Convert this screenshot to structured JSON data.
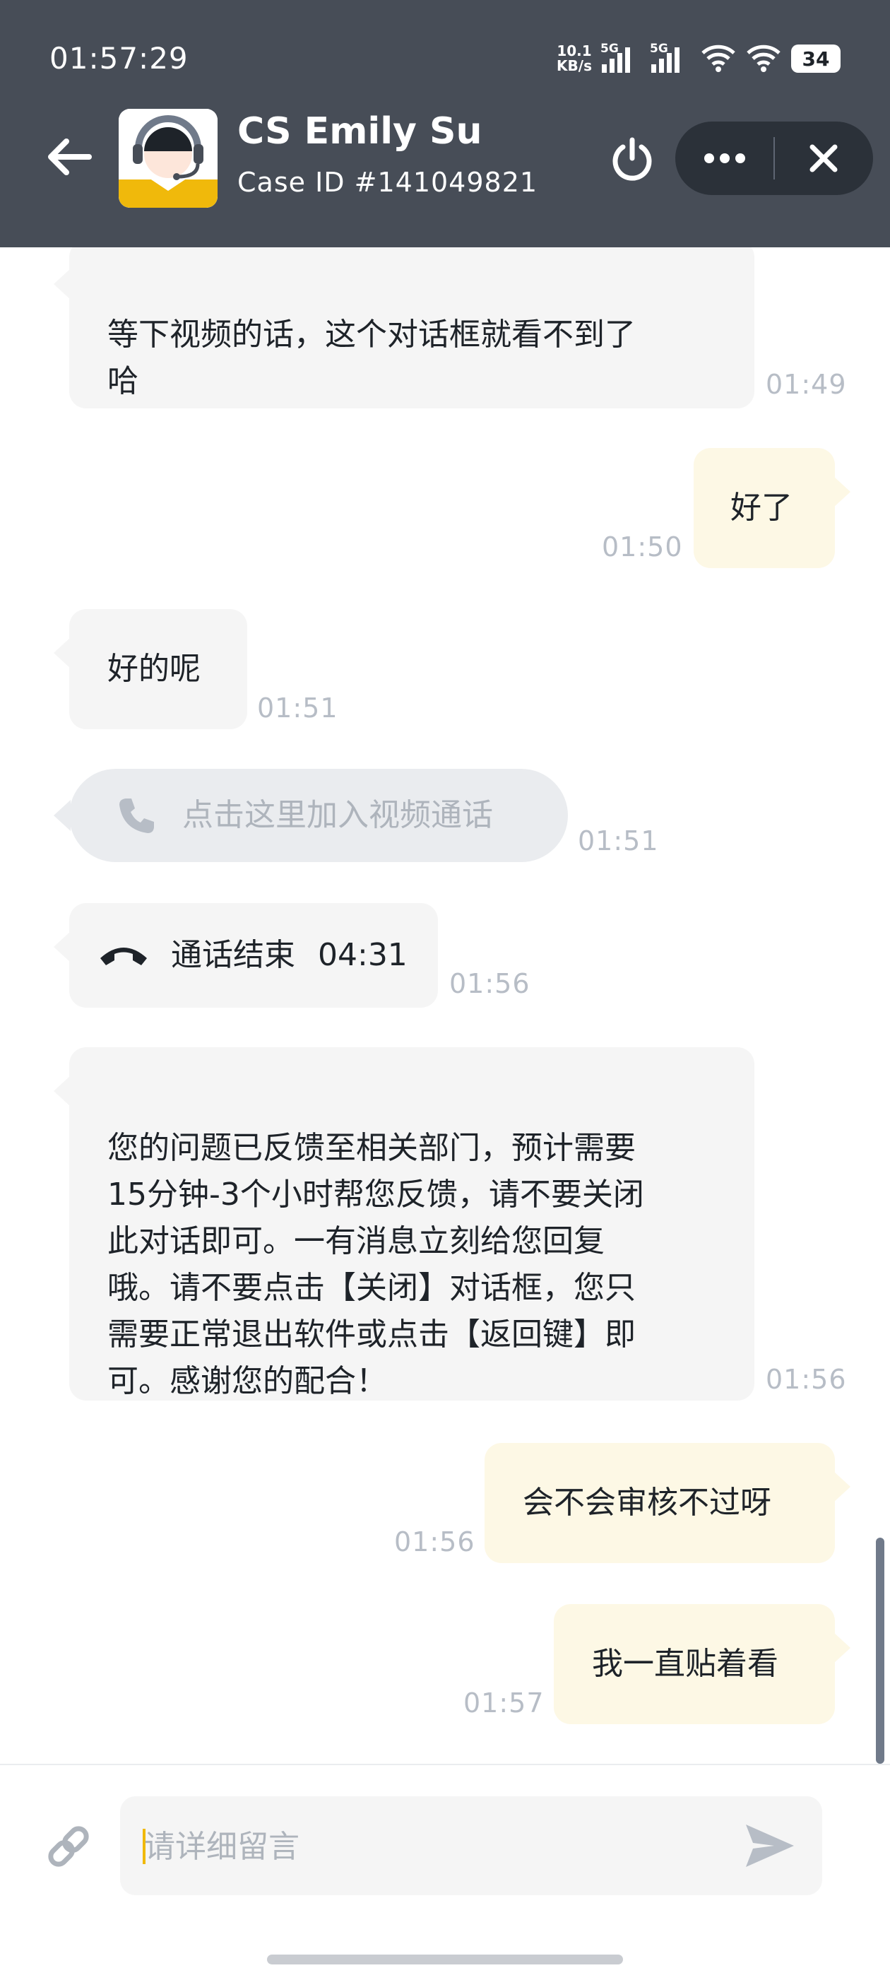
{
  "status_bar": {
    "time": "01:57:29",
    "net_speed": "10.1\nKB/s",
    "signal_1_label": "5G",
    "signal_2_label": "5G",
    "battery": "34"
  },
  "header": {
    "agent_name": "CS Emily Su",
    "case_id": "Case ID #141049821"
  },
  "messages": [
    {
      "from": "agent",
      "kind": "text",
      "text": "等下视频的话，这个对话框就看不到了\n哈",
      "time": "01:49"
    },
    {
      "from": "user",
      "kind": "text",
      "text": "好了",
      "time": "01:50"
    },
    {
      "from": "agent",
      "kind": "text",
      "text": "好的呢",
      "time": "01:51"
    },
    {
      "from": "agent",
      "kind": "call-invite",
      "text": "点击这里加入视频通话",
      "time": "01:51"
    },
    {
      "from": "agent",
      "kind": "call-ended",
      "text": "通话结束",
      "duration": "04:31",
      "time": "01:56"
    },
    {
      "from": "agent",
      "kind": "text",
      "text": "您的问题已反馈至相关部门，预计需要\n15分钟-3个小时帮您反馈，请不要关闭\n此对话即可。一有消息立刻给您回复\n哦。请不要点击【关闭】对话框，您只\n需要正常退出软件或点击【返回键】即\n可。感谢您的配合！",
      "time": "01:56"
    },
    {
      "from": "user",
      "kind": "text",
      "text": "会不会审核不过呀",
      "time": "01:56"
    },
    {
      "from": "user",
      "kind": "text",
      "text": "我一直贴着看",
      "time": "01:57"
    }
  ],
  "composer": {
    "placeholder": "请详细留言",
    "value": ""
  },
  "icons": {
    "back": "arrow-left-icon",
    "avatar": "support-agent-avatar",
    "power": "power-icon",
    "more": "more-dots-icon",
    "close": "close-icon",
    "attach": "link-icon",
    "send": "send-icon",
    "phone": "phone-icon",
    "hangup": "hangup-icon"
  },
  "colors": {
    "header_bg": "#474d57",
    "agent_bubble": "#f5f5f5",
    "user_bubble": "#fdf8e5",
    "accent": "#f0b90b",
    "timestamp": "#b7bdc6"
  }
}
